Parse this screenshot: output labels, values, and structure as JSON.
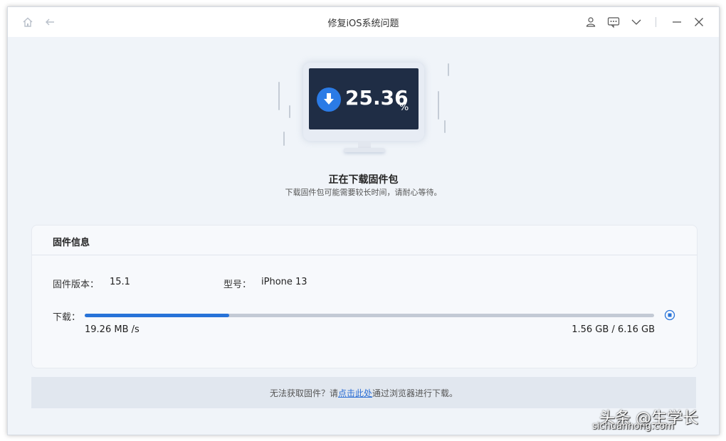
{
  "window": {
    "title": "修复iOS系统问题"
  },
  "titlebar": {
    "icons": [
      "home-icon",
      "back-arrow-icon",
      "user-icon",
      "feedback-icon",
      "chevron-down-icon",
      "minimize-icon",
      "close-icon"
    ]
  },
  "progress": {
    "percent_text": "25.36",
    "percent_sign": "%",
    "fraction": 0.2536,
    "title": "正在下载固件包",
    "subtitle": "下载固件包可能需要较长时间，请耐心等待。"
  },
  "firmware": {
    "section_title": "固件信息",
    "version_label": "固件版本：",
    "version_value": "15.1",
    "model_label": "型号：",
    "model_value": "iPhone 13",
    "download_label": "下载：",
    "speed": "19.26 MB /s",
    "size": "1.56 GB / 6.16 GB"
  },
  "footer": {
    "prefix": "无法获取固件？请",
    "link": "点击此处",
    "suffix": "通过浏览器进行下载。"
  },
  "watermark": {
    "line1": "头条 @生学长",
    "line2": "sichuanhong.com"
  },
  "colors": {
    "accent": "#2873d8",
    "screen": "#1f2d45",
    "background": "#f0f4f9"
  }
}
